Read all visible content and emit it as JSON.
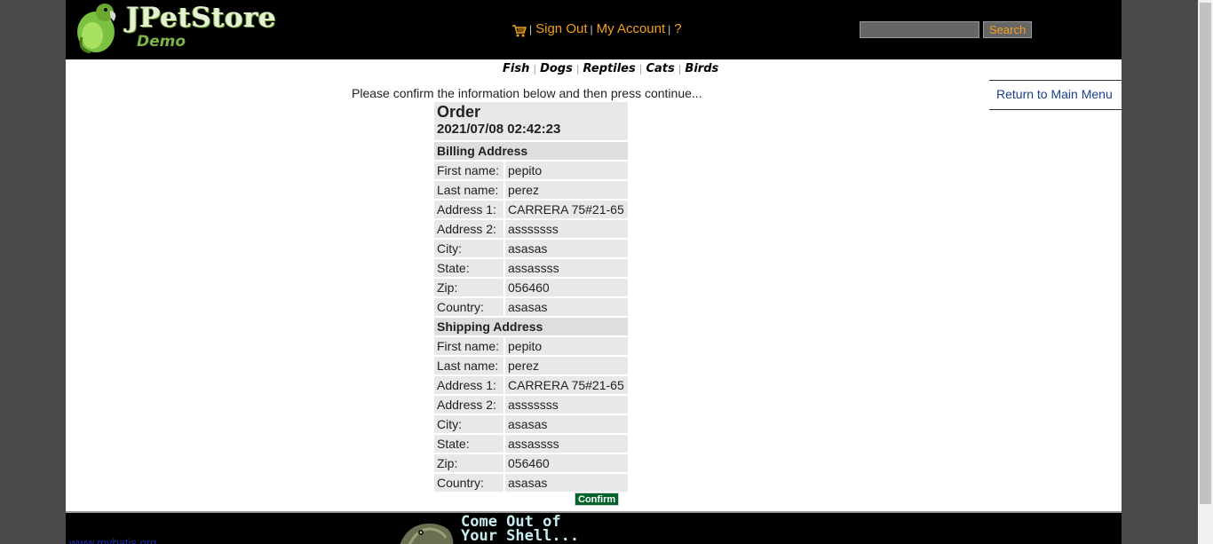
{
  "header": {
    "logo_title": "JPetStore",
    "logo_subtitle": "Demo",
    "menu": {
      "sign_out": "Sign Out",
      "my_account": "My Account",
      "help": "?"
    },
    "search": {
      "value": "",
      "button": "Search"
    }
  },
  "quicklinks": [
    "Fish",
    "Dogs",
    "Reptiles",
    "Cats",
    "Birds"
  ],
  "return_link": "Return to Main Menu",
  "instructions": "Please confirm the information below and then press continue...",
  "order": {
    "title": "Order",
    "date": "2021/07/08 02:42:23",
    "billing": {
      "heading": "Billing Address",
      "first_name_label": "First name:",
      "first_name": "pepito",
      "last_name_label": "Last name:",
      "last_name": "perez",
      "address1_label": "Address 1:",
      "address1": "CARRERA 75#21-65",
      "address2_label": "Address 2:",
      "address2": "asssssss",
      "city_label": "City:",
      "city": "asasas",
      "state_label": "State:",
      "state": "assassss",
      "zip_label": "Zip:",
      "zip": "056460",
      "country_label": "Country:",
      "country": "asasas"
    },
    "shipping": {
      "heading": "Shipping Address",
      "first_name_label": "First name:",
      "first_name": "pepito",
      "last_name_label": "Last name:",
      "last_name": "perez",
      "address1_label": "Address 1:",
      "address1": "CARRERA 75#21-65",
      "address2_label": "Address 2:",
      "address2": "asssssss",
      "city_label": "City:",
      "city": "asasas",
      "state_label": "State:",
      "state": "assassss",
      "zip_label": "Zip:",
      "zip": "056460",
      "country_label": "Country:",
      "country": "asasas"
    },
    "confirm_button": "Confirm"
  },
  "footer": {
    "link": "www.mybatis.org",
    "banner_line1": "Come Out of",
    "banner_line2": "Your Shell..."
  },
  "colors": {
    "header_bg": "#000000",
    "link_orange": "#f0a020",
    "confirm_green": "#00642a",
    "cell_bg": "#e8e8e8"
  }
}
